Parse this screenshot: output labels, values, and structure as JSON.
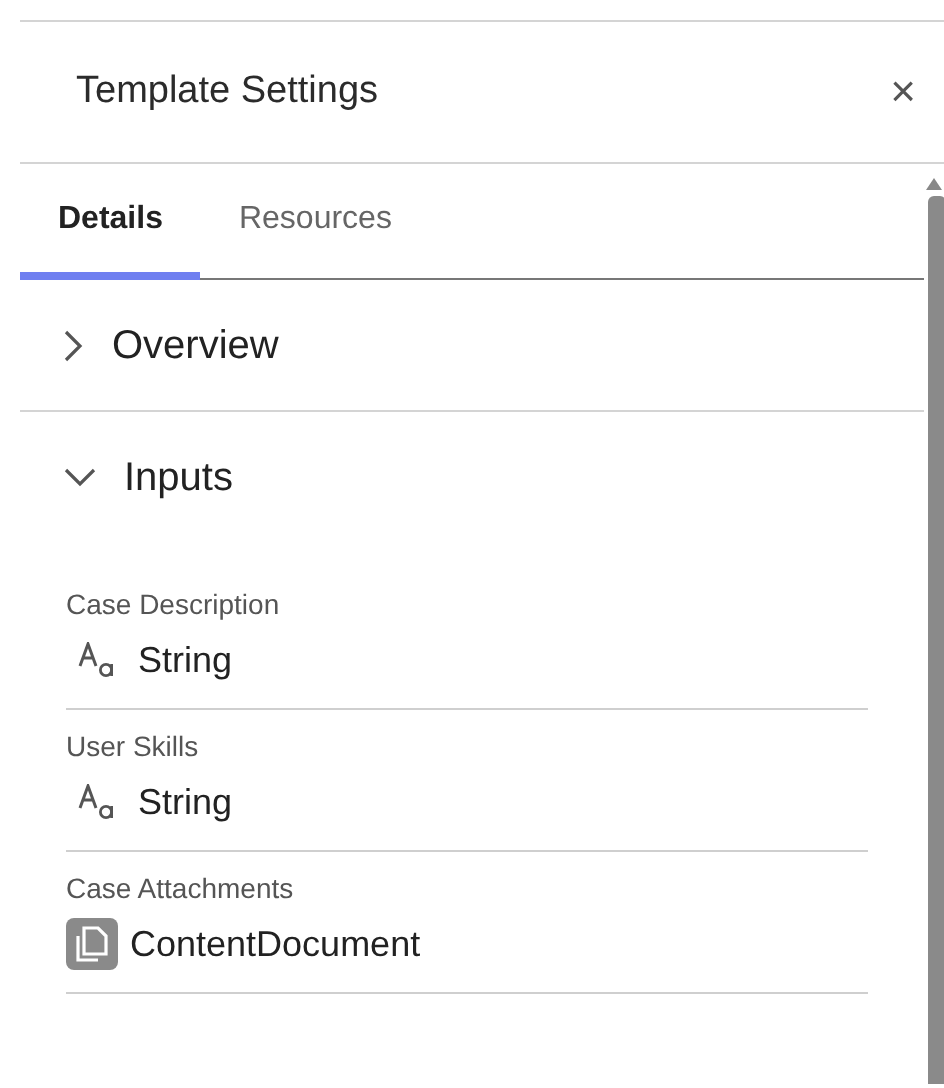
{
  "panel": {
    "title": "Template Settings",
    "close": "×"
  },
  "tabs": [
    {
      "label": "Details",
      "selected": true
    },
    {
      "label": "Resources",
      "selected": false
    }
  ],
  "sections": [
    {
      "title": "Overview",
      "expanded": false
    },
    {
      "title": "Inputs",
      "expanded": true,
      "inputs": [
        {
          "label": "Case Description",
          "kind": "text",
          "type": "String"
        },
        {
          "label": "User Skills",
          "kind": "text",
          "type": "String"
        },
        {
          "label": "Case Attachments",
          "kind": "document",
          "type": "ContentDocument"
        }
      ]
    }
  ]
}
